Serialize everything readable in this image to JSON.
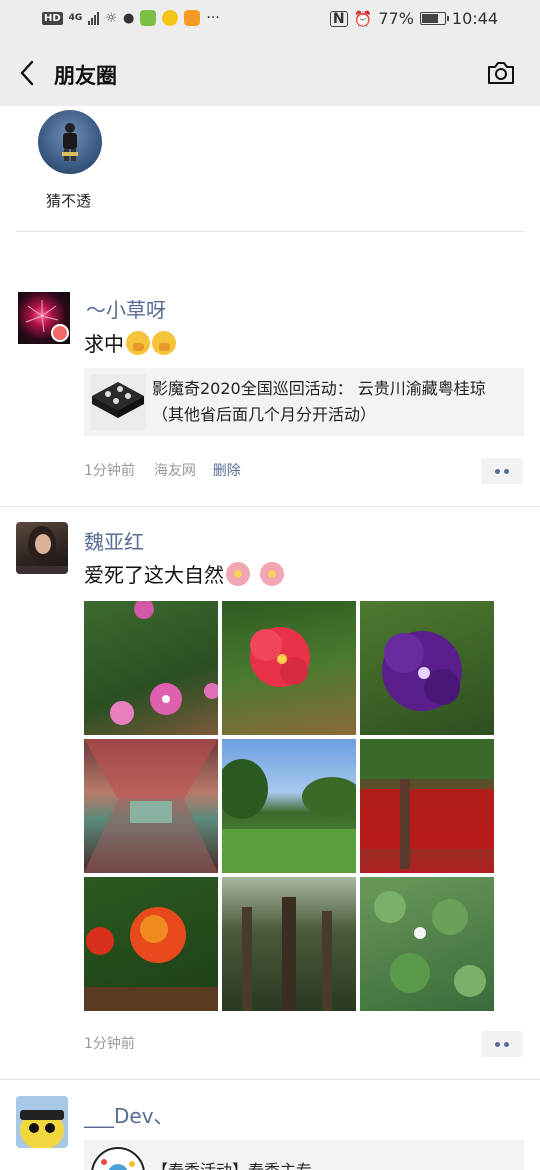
{
  "status_bar": {
    "hd": "HD",
    "network": "4G",
    "battery": "77%",
    "time": "10:44",
    "more": "···"
  },
  "nav": {
    "title": "朋友圈"
  },
  "visitor": {
    "name": "猜不透"
  },
  "posts": [
    {
      "username": "～小草呀",
      "text": "求中",
      "share_card": {
        "title": "影魔奇2020全国巡回活动： 云贵川渝藏粤桂琼（其他省后面几个月分开活动）"
      },
      "time": "1分钟前",
      "source": "海友网",
      "delete": "删除"
    },
    {
      "username": "魏亚红",
      "text": "爱死了这大自然",
      "time": "1分钟前",
      "photos": [
        "pink-flowers",
        "red-hibiscus",
        "purple-flower",
        "colorful-corridor",
        "green-lawn",
        "red-ribbons-tree",
        "red-orange-lantana",
        "banyan-trees",
        "lotus-pond"
      ]
    },
    {
      "username": "___Dev、",
      "share_card": {
        "title": "【春季活动】春季主专"
      }
    }
  ]
}
